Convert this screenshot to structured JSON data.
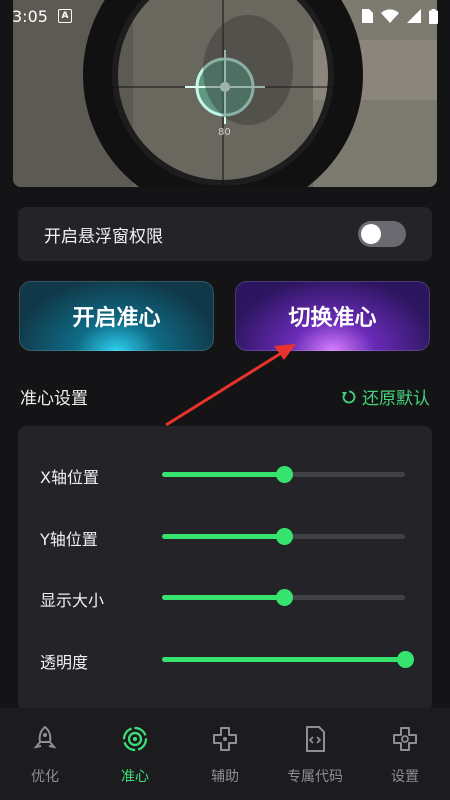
{
  "status_bar": {
    "time": "3:05",
    "app_icon": "A"
  },
  "preview": {
    "ammo_count": "80"
  },
  "floating_window": {
    "label": "开启悬浮窗权限",
    "enabled": false
  },
  "buttons": {
    "open_crosshair": "开启准心",
    "switch_crosshair": "切换准心"
  },
  "settings": {
    "title": "准心设置",
    "reset_label": "还原默认",
    "sliders": [
      {
        "label": "X轴位置",
        "value": 0.5
      },
      {
        "label": "Y轴位置",
        "value": 0.5
      },
      {
        "label": "显示大小",
        "value": 0.5
      },
      {
        "label": "透明度",
        "value": 1.0
      }
    ]
  },
  "nav": {
    "items": [
      {
        "label": "优化",
        "icon": "rocket-icon",
        "active": false
      },
      {
        "label": "准心",
        "icon": "crosshair-icon",
        "active": true
      },
      {
        "label": "辅助",
        "icon": "gamepad-icon",
        "active": false
      },
      {
        "label": "专属代码",
        "icon": "code-file-icon",
        "active": false
      },
      {
        "label": "设置",
        "icon": "gamepad-settings-icon",
        "active": false
      }
    ]
  },
  "colors": {
    "accent": "#35e36e",
    "background": "#141416",
    "card": "#242428"
  }
}
